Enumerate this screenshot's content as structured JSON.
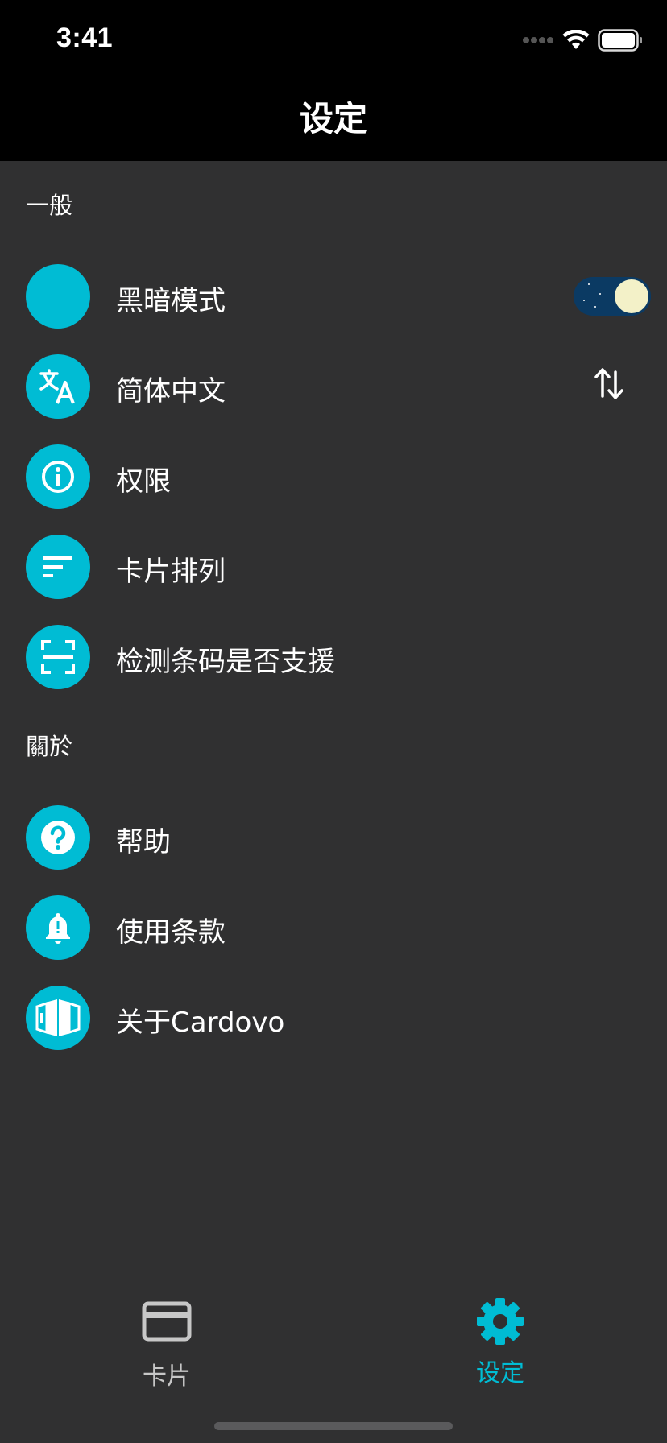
{
  "status_bar": {
    "time": "3:41"
  },
  "nav": {
    "title": "设定"
  },
  "sections": {
    "general": {
      "title": "一般",
      "items": [
        {
          "label": "黑暗模式",
          "icon": "moon-icon"
        },
        {
          "label": "简体中文",
          "icon": "translate-icon"
        },
        {
          "label": "权限",
          "icon": "info-icon"
        },
        {
          "label": "卡片排列",
          "icon": "sort-icon"
        },
        {
          "label": "检测条码是否支援",
          "icon": "scan-icon"
        }
      ]
    },
    "about": {
      "title": "關於",
      "items": [
        {
          "label": "帮助",
          "icon": "help-icon"
        },
        {
          "label": "使用条款",
          "icon": "bell-icon"
        },
        {
          "label": "关于Cardovo",
          "icon": "cards-icon"
        }
      ]
    }
  },
  "dark_mode_enabled": true,
  "tabs": [
    {
      "label": "卡片",
      "icon": "card-icon",
      "active": false
    },
    {
      "label": "设定",
      "icon": "gear-icon",
      "active": true
    }
  ],
  "colors": {
    "accent": "#00bcd4",
    "background": "#303031",
    "header": "#000000",
    "inactive_tab": "#c7c7c7",
    "toggle_track": "#0b3a63",
    "toggle_knob": "#f3f1c8"
  }
}
